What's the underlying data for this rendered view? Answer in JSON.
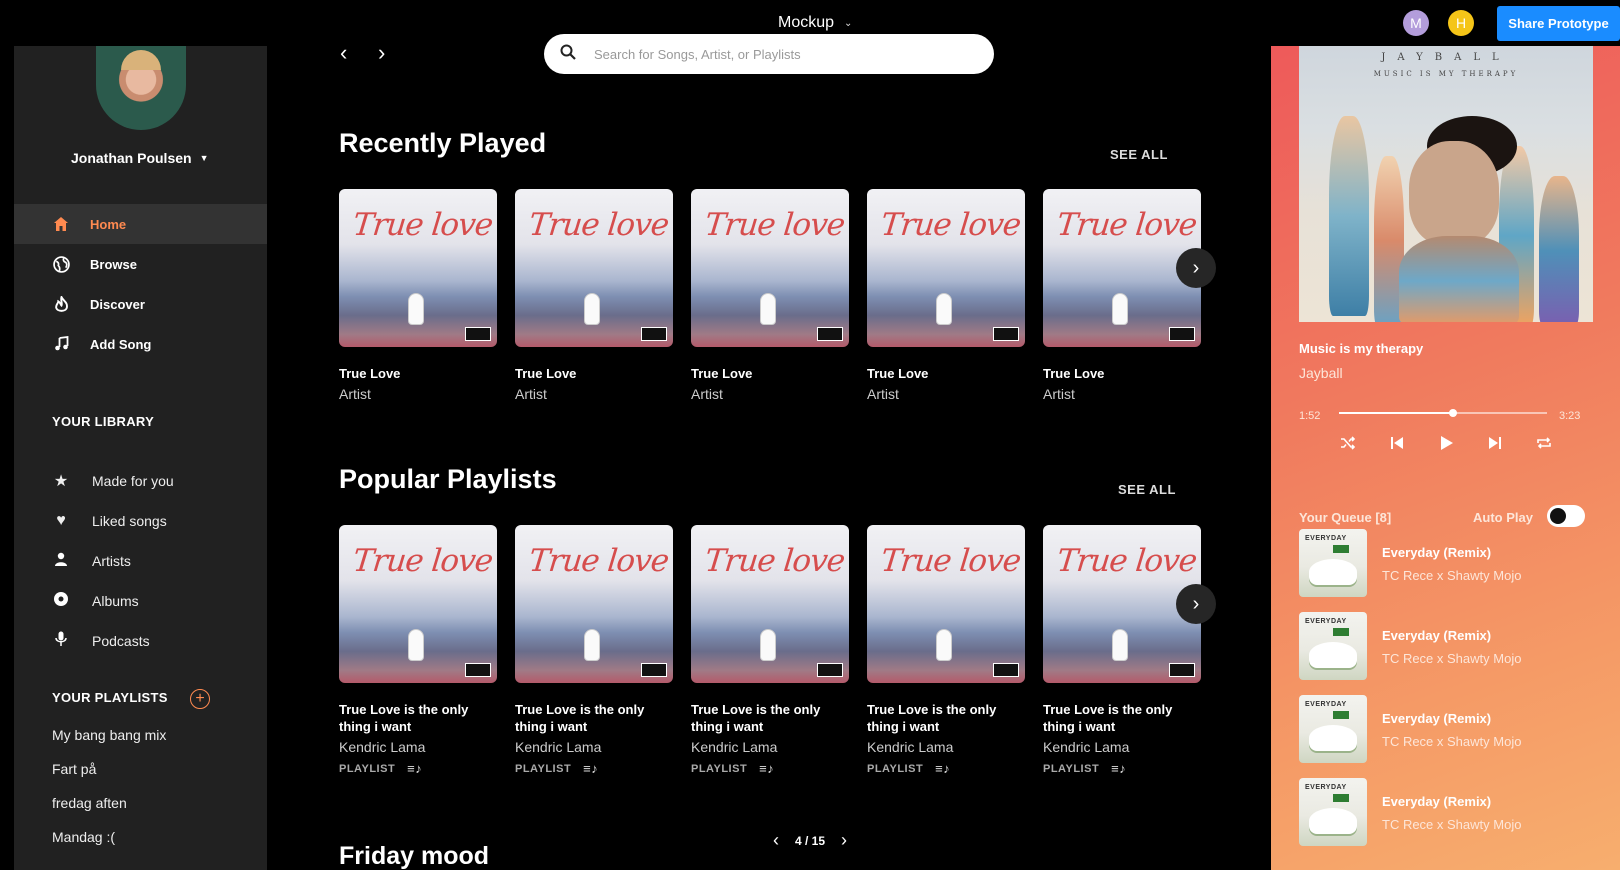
{
  "topbar": {
    "title": "Mockup",
    "avatars": [
      "M",
      "H"
    ],
    "share_label": "Share Prototype"
  },
  "profile": {
    "name": "Jonathan Poulsen"
  },
  "nav": [
    {
      "label": "Home",
      "icon": "home-icon",
      "active": true
    },
    {
      "label": "Browse",
      "icon": "globe-icon"
    },
    {
      "label": "Discover",
      "icon": "flame-icon"
    },
    {
      "label": "Add Song",
      "icon": "music-note-icon"
    }
  ],
  "library": {
    "title": "YOUR LIBRARY",
    "items": [
      {
        "label": "Made for you",
        "icon": "star-icon"
      },
      {
        "label": "Liked songs",
        "icon": "heart-icon"
      },
      {
        "label": "Artists",
        "icon": "person-icon"
      },
      {
        "label": "Albums",
        "icon": "disc-icon"
      },
      {
        "label": "Podcasts",
        "icon": "microphone-icon"
      }
    ]
  },
  "playlists": {
    "title": "YOUR PLAYLISTS",
    "items": [
      "My bang bang mix",
      "Fart på",
      "fredag aften",
      "Mandag :("
    ]
  },
  "search": {
    "placeholder": "Search for Songs, Artist, or Playlists"
  },
  "recently_played": {
    "title": "Recently Played",
    "see_all": "SEE ALL",
    "cover_text": "True love",
    "cards": [
      {
        "title": "True Love",
        "artist": "Artist"
      },
      {
        "title": "True Love",
        "artist": "Artist"
      },
      {
        "title": "True Love",
        "artist": "Artist"
      },
      {
        "title": "True Love",
        "artist": "Artist"
      },
      {
        "title": "True Love",
        "artist": "Artist"
      }
    ]
  },
  "popular_playlists": {
    "title": "Popular Playlists",
    "see_all": "SEE ALL",
    "cover_text": "True love",
    "cards": [
      {
        "title": "True Love is the only thing i want",
        "artist": "Kendric Lama",
        "tag": "PLAYLIST"
      },
      {
        "title": "True Love is the only thing i want",
        "artist": "Kendric Lama",
        "tag": "PLAYLIST"
      },
      {
        "title": "True Love is the only thing i want",
        "artist": "Kendric Lama",
        "tag": "PLAYLIST"
      },
      {
        "title": "True Love is the only thing i want",
        "artist": "Kendric Lama",
        "tag": "PLAYLIST"
      },
      {
        "title": "True Love is the only thing i want",
        "artist": "Kendric Lama",
        "tag": "PLAYLIST"
      }
    ]
  },
  "friday_mood": {
    "title": "Friday mood"
  },
  "pager": {
    "label": "4 / 15"
  },
  "player": {
    "album_band": "JAYBALL",
    "album_subtitle": "MUSIC IS MY THERAPY",
    "song_title": "Music is my therapy",
    "artist": "Jayball",
    "elapsed": "1:52",
    "duration": "3:23",
    "progress": 0.55,
    "queue_title": "Your Queue [8]",
    "autoplay_label": "Auto Play",
    "autoplay_on": true,
    "queue": [
      {
        "title": "Everyday (Remix)",
        "artist": "TC Rece x Shawty Mojo",
        "art_text": "EVERYDAY"
      },
      {
        "title": "Everyday (Remix)",
        "artist": "TC Rece x Shawty Mojo",
        "art_text": "EVERYDAY"
      },
      {
        "title": "Everyday (Remix)",
        "artist": "TC Rece x Shawty Mojo",
        "art_text": "EVERYDAY"
      },
      {
        "title": "Everyday (Remix)",
        "artist": "TC Rece x Shawty Mojo",
        "art_text": "EVERYDAY"
      }
    ]
  },
  "colors": {
    "accent": "#ff8a50",
    "share": "#1a8cff",
    "sidebar": "#212121"
  }
}
